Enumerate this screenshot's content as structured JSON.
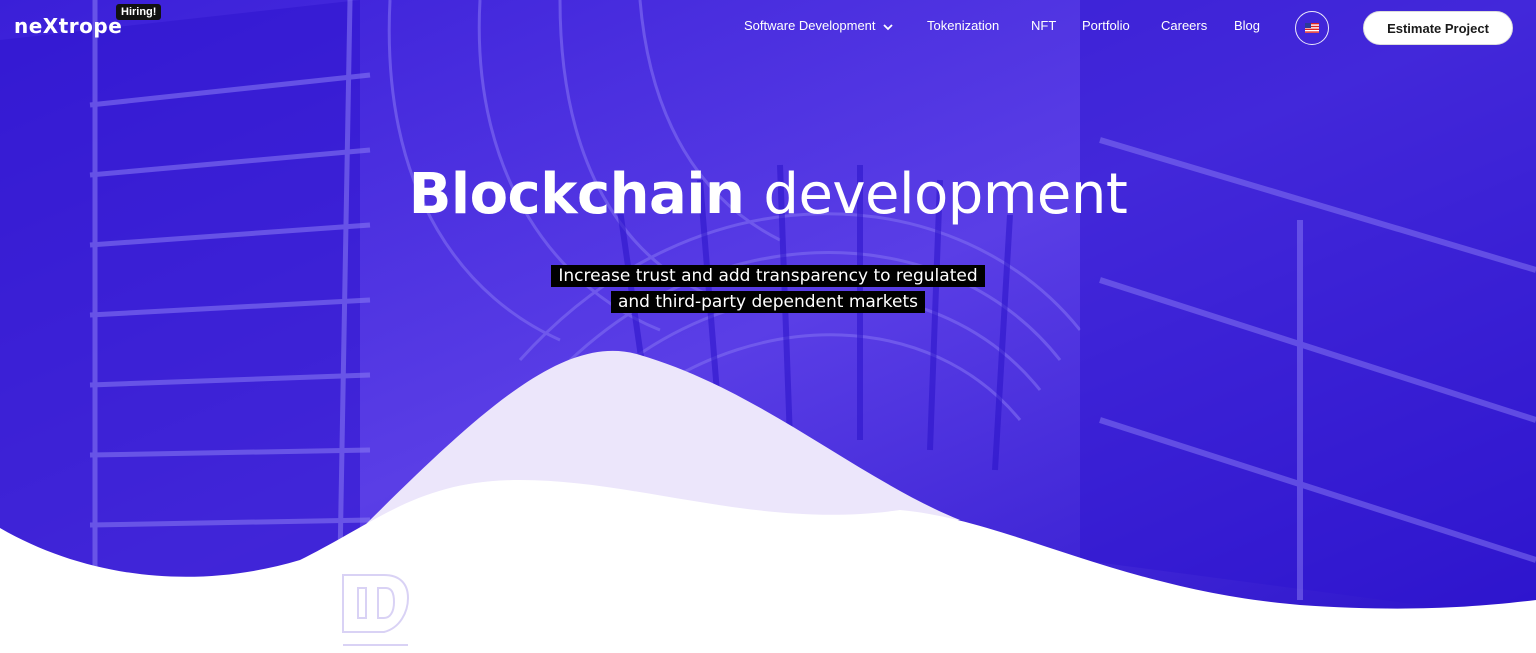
{
  "brand": {
    "logo_text": "neXtrope",
    "hiring_badge": "Hiring!"
  },
  "nav": {
    "items": [
      {
        "label": "Software Development",
        "has_dropdown": true
      },
      {
        "label": "Tokenization"
      },
      {
        "label": "NFT"
      },
      {
        "label": "Portfolio"
      },
      {
        "label": "Careers"
      },
      {
        "label": "Blog"
      }
    ],
    "language_icon": "us-flag-icon",
    "cta_label": "Estimate Project"
  },
  "hero": {
    "headline_strong": "Blockchain",
    "headline_light": "development",
    "subtitle_line1": "Increase trust and add transparency to regulated",
    "subtitle_line2": "and third-party dependent markets"
  },
  "colors": {
    "hero_purple": "#4a2ee0",
    "deep_blue": "#2a12c9",
    "lavender_wave": "#ece6fb",
    "white": "#ffffff"
  }
}
